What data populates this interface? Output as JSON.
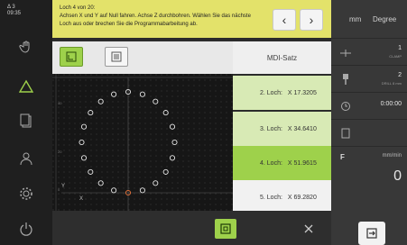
{
  "status": {
    "line1_left": "Δ 3",
    "line1_right": "",
    "line2_left": "09:35"
  },
  "message": {
    "line1": "Loch 4 von 20:",
    "line2": "Achsen X und Y auf Null fahren. Achse Z durchbohren. Wählen Sie das nächste",
    "line3": "Loch aus oder brechen Sie die Programmabarbeitung ab.",
    "prev_icon": "‹",
    "next_icon": "›"
  },
  "mdi": {
    "header": "MDI-Satz",
    "items": [
      {
        "label": "2. Loch:",
        "x": "X 17.3205"
      },
      {
        "label": "3. Loch:",
        "x": "X 34.6410"
      },
      {
        "label": "4. Loch:",
        "x": "X 51.9615"
      },
      {
        "label": "5. Loch:",
        "x": "X 69.2820"
      }
    ]
  },
  "plot": {
    "y_label": "Y",
    "x_label": "X",
    "tick_0": "0",
    "tick_20": "20",
    "tick_40": "40"
  },
  "right_panel": {
    "unit_length": "mm",
    "unit_angle": "Degree",
    "clamp_value": "1",
    "clamp_label": "CLAMP",
    "drill_value": "2",
    "drill_label": "DRILL 8 mm",
    "time_value": "0:00:00",
    "feed_label": "F",
    "feed_unit": "mm/min",
    "feed_value": "0"
  },
  "colors": {
    "accent_green": "#9ed14b",
    "message_yellow": "#e3e26a",
    "hole_color": "#e6e6e6",
    "current_hole": "#e8743b"
  }
}
